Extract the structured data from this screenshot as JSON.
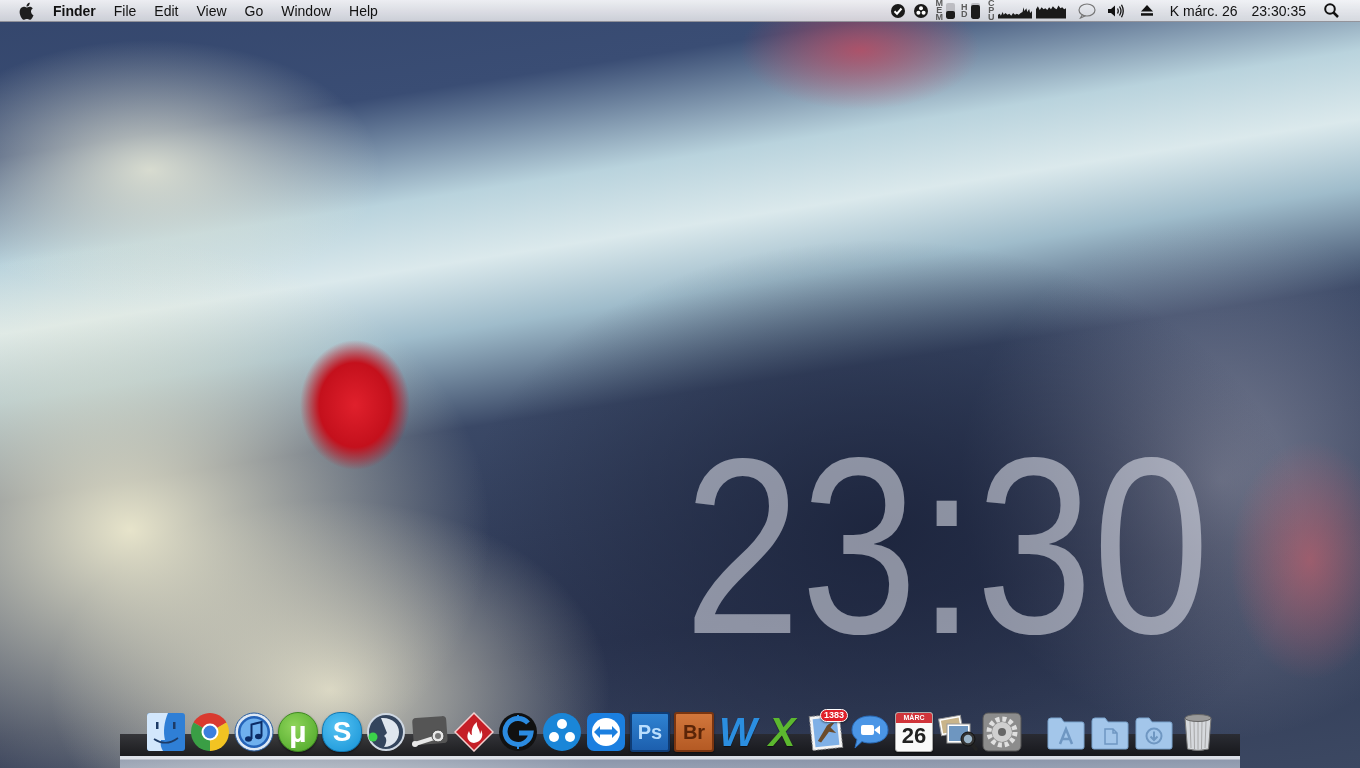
{
  "menu_bar": {
    "app_name": "Finder",
    "menus": [
      "File",
      "Edit",
      "View",
      "Go",
      "Window",
      "Help"
    ],
    "status": {
      "meters": [
        {
          "label": "MEM",
          "level": 0.45
        },
        {
          "label": "HD",
          "level": 0.85
        }
      ],
      "cpu_label": "CPU",
      "date": "K márc. 26",
      "time": "23:30:35"
    }
  },
  "desktop_clock": {
    "time": "23:30"
  },
  "dock": {
    "apps": [
      {
        "kind": "finder"
      },
      {
        "kind": "chrome"
      },
      {
        "kind": "itunes"
      },
      {
        "kind": "utorrent",
        "label": "µ"
      },
      {
        "kind": "skype",
        "label": "S"
      },
      {
        "kind": "teamspeak"
      },
      {
        "kind": "steam"
      },
      {
        "kind": "flame"
      },
      {
        "kind": "crosshair"
      },
      {
        "kind": "dots"
      },
      {
        "kind": "teamviewer"
      },
      {
        "kind": "photoshop",
        "label": "Ps"
      },
      {
        "kind": "bridge",
        "label": "Br"
      },
      {
        "kind": "word",
        "label": "W"
      },
      {
        "kind": "excel",
        "label": "X"
      },
      {
        "kind": "mail",
        "badge": "1383"
      },
      {
        "kind": "facetime"
      },
      {
        "kind": "calendar",
        "month": "MÁRC",
        "day": "26"
      },
      {
        "kind": "iphoto"
      },
      {
        "kind": "preferences"
      }
    ],
    "stacks": [
      {
        "kind": "applications"
      },
      {
        "kind": "documents"
      },
      {
        "kind": "downloads"
      },
      {
        "kind": "trash"
      }
    ]
  }
}
